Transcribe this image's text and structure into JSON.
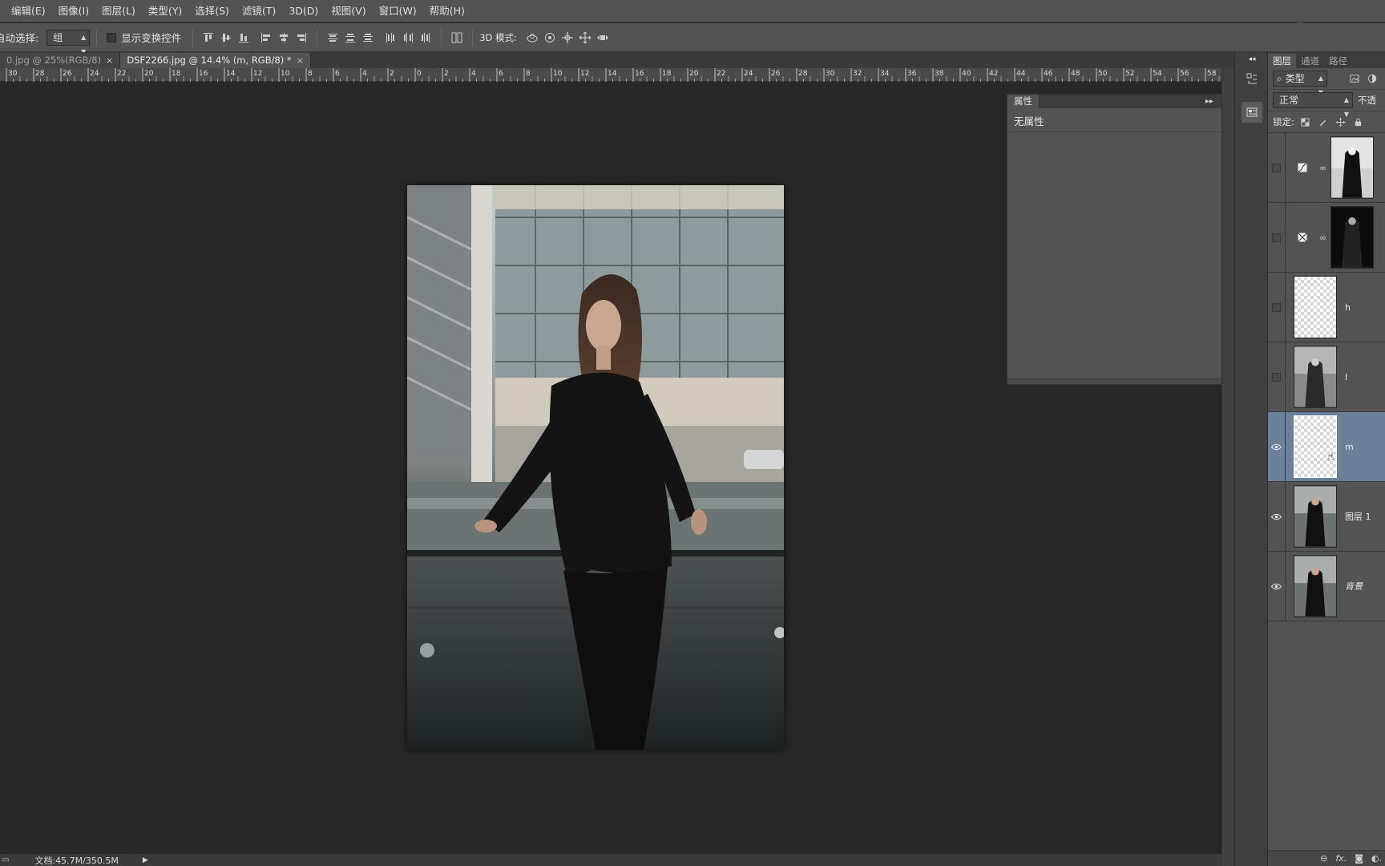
{
  "menubar": {
    "items": [
      "编辑(E)",
      "图像(I)",
      "图层(L)",
      "类型(Y)",
      "选择(S)",
      "滤镜(T)",
      "3D(D)",
      "视图(V)",
      "窗口(W)",
      "帮助(H)"
    ]
  },
  "options": {
    "auto_select_label": "自动选择:",
    "auto_select_value": "组",
    "show_transform_label": "显示变换控件",
    "mode_3d_label": "3D 模式:"
  },
  "tabs": [
    {
      "label": "0.jpg @ 25%(RGB/8)",
      "close": "×"
    },
    {
      "label": "DSF2266.jpg @ 14.4% (m, RGB/8) *",
      "close": "×"
    }
  ],
  "ruler": {
    "labels": [
      "30",
      "28",
      "26",
      "24",
      "22",
      "20",
      "18",
      "16",
      "14",
      "12",
      "10",
      "8",
      "6",
      "4",
      "2",
      "0",
      "2",
      "4",
      "6",
      "8",
      "10",
      "12",
      "14",
      "16",
      "18",
      "20",
      "22",
      "24",
      "26",
      "28",
      "30",
      "32",
      "34",
      "36",
      "38",
      "40",
      "42",
      "44",
      "46",
      "48",
      "50",
      "52",
      "54",
      "56",
      "58"
    ]
  },
  "properties": {
    "tab": "属性",
    "body": "无属性"
  },
  "layers": {
    "tabs": [
      "图层",
      "通道",
      "路径"
    ],
    "filter_kind": "类型",
    "blend_mode": "正常",
    "opacity_label": "不透",
    "lock_label": "锁定:",
    "items": [
      {
        "name": "",
        "visible": false,
        "kind": "curves-adjustment",
        "thumb": "photo",
        "selected": false
      },
      {
        "name": "",
        "visible": false,
        "kind": "channel-mixer-adjustment",
        "thumb": "photo-dark",
        "selected": false
      },
      {
        "name": "h",
        "visible": false,
        "kind": "pixel",
        "thumb": "transparent",
        "selected": false
      },
      {
        "name": "l",
        "visible": false,
        "kind": "pixel",
        "thumb": "photo-gray",
        "selected": false
      },
      {
        "name": "m",
        "visible": true,
        "kind": "pixel",
        "thumb": "transparent",
        "selected": true
      },
      {
        "name": "图层 1",
        "visible": true,
        "kind": "pixel",
        "thumb": "photo",
        "selected": false
      },
      {
        "name": "背景",
        "visible": true,
        "kind": "pixel",
        "thumb": "photo",
        "selected": false,
        "italic": true
      }
    ],
    "footer_icons": [
      "link-icon",
      "fx-icon",
      "mask-icon",
      "adjustment-icon"
    ]
  },
  "status": {
    "doc_size": "文档:45.7M/350.5M"
  },
  "watermark": {
    "text": "羽"
  },
  "colors": {
    "accent_selected": "#6c8198",
    "panel_bg": "#535353",
    "canvas_bg": "#282828"
  }
}
